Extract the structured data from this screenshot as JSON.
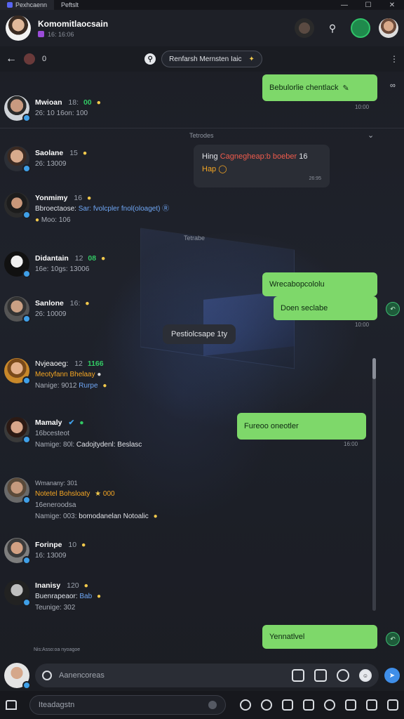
{
  "window": {
    "tabs": [
      "Pexhcaenn",
      "Peftslt"
    ],
    "controls": [
      "—",
      "☐",
      "✕"
    ]
  },
  "header": {
    "title": "Komomitlaocsain",
    "subtitle": "16: 16:06"
  },
  "subheader": {
    "count": "0",
    "search_placeholder": "Renfarsh Mernsten Iaic",
    "more": "⋮"
  },
  "messages": {
    "r1": {
      "name": "Mwioan",
      "time": "18:",
      "tag": "00",
      "sub": "26: 10 16on: 100"
    },
    "r2": {
      "name": "Saolane",
      "time": "15",
      "sub": "26: 13009"
    },
    "r3": {
      "name": "Yonmimy",
      "time": "16",
      "text": "Bbroectaose:",
      "link": "Sar: fvolcpler fnol(oloaget) Ⓡ",
      "sub": "Moo: 106"
    },
    "r4": {
      "name": "Didantain",
      "time": "12",
      "tag": "08",
      "sub": "16e: 10gs: 13006"
    },
    "r5": {
      "name": "Sanlone",
      "time": "16:",
      "sub": "26: 10009"
    },
    "r6": {
      "name": "Nvjeaoeg:",
      "time": "12",
      "tag": "1166",
      "text": "Meotyfann Bhelaay",
      "sub": "Nanige: 9012",
      "link": "Rurpe"
    },
    "r7": {
      "name": "Mamaly",
      "sub": "16bcesteot",
      "line3": "Namige: 80l:",
      "link": "Cadojtydenl: Beslasc"
    },
    "r8": {
      "name": "Wmanany: 301",
      "text": "Notetel Bohsloaty",
      "tag": "000",
      "sub": "16eneroodsa",
      "line3": "Namige: 003:",
      "link": "bomodanelan Notoalic"
    },
    "r9": {
      "name": "Forinpe",
      "time": "10",
      "sub": "16: 13009"
    },
    "r10": {
      "name": "Inanisy",
      "time": "120",
      "text": "Buenrapeaor:",
      "link": "Bab",
      "sub": "Teunige: 302"
    }
  },
  "bubbles": {
    "g1": "Bebulorlie chentlack",
    "g1_ts": "10:00",
    "g2": "Wrecabopcololu",
    "g3": "Doen seclabe",
    "g3_ts": "10:00",
    "g4": "Fureoo oneotler",
    "g4_ts": "16:00",
    "g5": "Yennatlvel"
  },
  "dark_bubble": {
    "line1a": "Hing",
    "line1b": "Cagnegheap:b boeber",
    "line1c": "16",
    "line2": "Hap",
    "ts": "26:95"
  },
  "separators": {
    "s1": "Tetrodes",
    "s2": "Tetrabe"
  },
  "chip": "Pestiolcsape 1ty",
  "footer_label": "Nis:Asso:oa nyoagoe",
  "composer": {
    "placeholder": "Aanencoreas"
  },
  "bottombar": {
    "placeholder": "Iteadagstn"
  }
}
